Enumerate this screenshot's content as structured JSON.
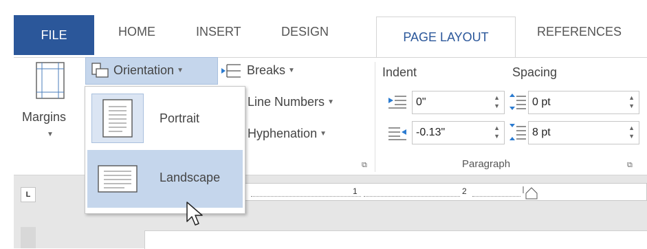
{
  "tabs": {
    "file": "FILE",
    "home": "HOME",
    "insert": "INSERT",
    "design": "DESIGN",
    "page_layout": "PAGE LAYOUT",
    "references": "REFERENCES"
  },
  "ribbon": {
    "margins_label": "Margins",
    "orientation_label": "Orientation",
    "breaks_label": "Breaks",
    "line_numbers_label": "Line Numbers",
    "hyphenation_label": "Hyphenation",
    "indent_heading": "Indent",
    "spacing_heading": "Spacing",
    "indent_left_value": "0\"",
    "indent_right_value": "-0.13\"",
    "spacing_before_value": "0 pt",
    "spacing_after_value": "8 pt",
    "paragraph_group_label": "Paragraph"
  },
  "orientation_menu": {
    "items": [
      {
        "label": "Portrait",
        "icon": "portrait-page-icon"
      },
      {
        "label": "Landscape",
        "icon": "landscape-page-icon",
        "highlighted": true
      }
    ]
  },
  "ruler": {
    "tab_selector": "L",
    "marks": [
      "1",
      "2"
    ]
  },
  "colors": {
    "file_tab_bg": "#2b579a",
    "active_tab_text": "#2b579a",
    "highlight_bg": "#c5d6ec",
    "selected_item_bg": "#dbe5f3"
  }
}
